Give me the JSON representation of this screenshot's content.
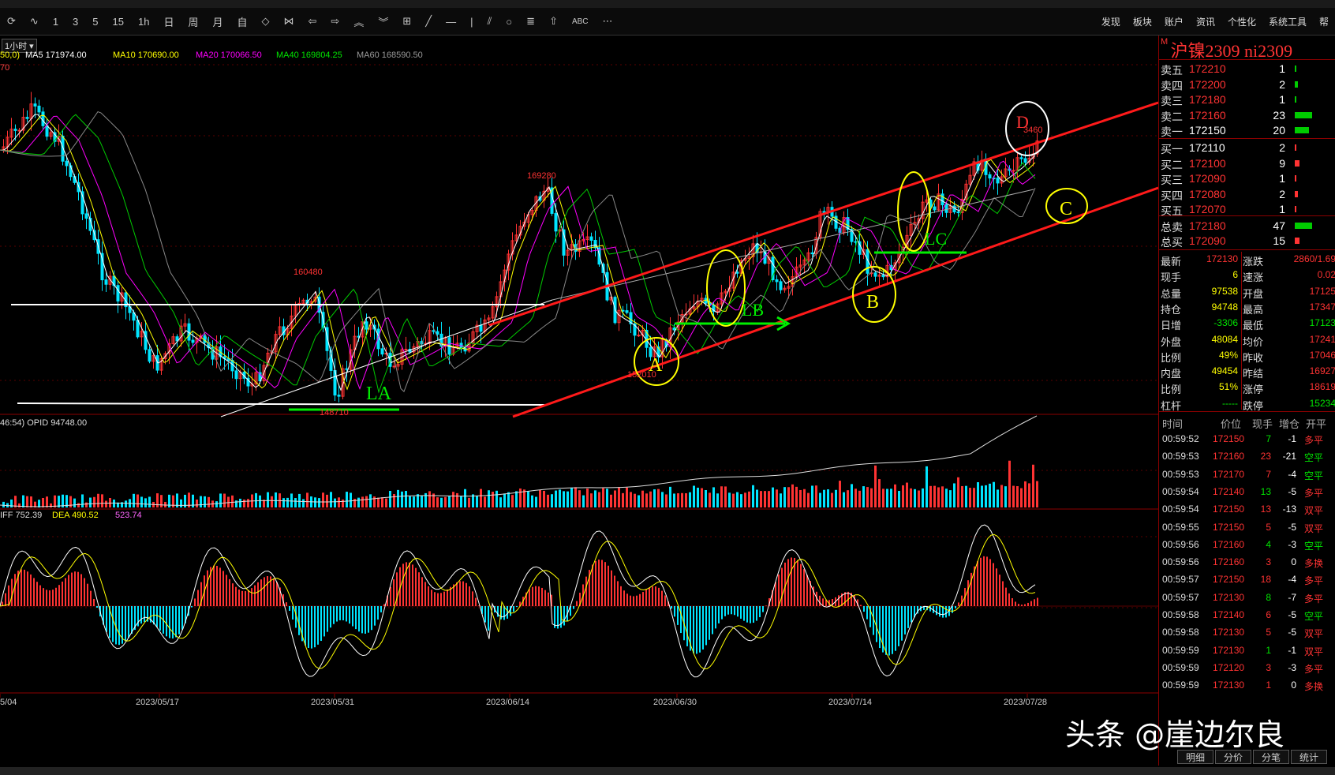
{
  "toolbar": {
    "periods": [
      "1",
      "3",
      "5",
      "15",
      "1h",
      "日",
      "周",
      "月",
      "自"
    ],
    "menu": [
      "发现",
      "板块",
      "账户",
      "资讯",
      "个性化",
      "系统工具",
      "帮"
    ]
  },
  "chart": {
    "period_select": "1小时",
    "ma_param": "50,0)",
    "ma": [
      {
        "label": "MA5 171974.00",
        "color": "#ffffff"
      },
      {
        "label": "MA10 170690.00",
        "color": "#ffff00"
      },
      {
        "label": "MA20 170066.50",
        "color": "#ff00ff"
      },
      {
        "label": "MA40 169804.25",
        "color": "#00e600"
      },
      {
        "label": "MA60 168590.50",
        "color": "#888888"
      }
    ],
    "left_edge_value": "70",
    "price_labels": {
      "p169280": "169280",
      "p160480": "160480",
      "p148710": "148710",
      "p152010": "152010",
      "p173460": "3460"
    },
    "annotations": {
      "A": "A",
      "B": "B",
      "C": "C",
      "D": "D",
      "LA": "LA",
      "LB": "LB",
      "LC": "LC"
    },
    "volume_header": "46:54)  OPID 94748.00",
    "macd_header": {
      "diff": "IFF 752.39",
      "dea": "DEA 490.52",
      "macd": "523.74"
    },
    "dates": [
      "5/04",
      "2023/05/17",
      "2023/05/31",
      "2023/06/14",
      "2023/06/30",
      "2023/07/14",
      "2023/07/28"
    ]
  },
  "panel": {
    "title": "沪镍2309  ni2309",
    "asks": [
      {
        "label": "卖五",
        "price": "172210",
        "vol": "1"
      },
      {
        "label": "卖四",
        "price": "172200",
        "vol": "2"
      },
      {
        "label": "卖三",
        "price": "172180",
        "vol": "1"
      },
      {
        "label": "卖二",
        "price": "172160",
        "vol": "23"
      },
      {
        "label": "卖一",
        "price": "172150",
        "vol": "20"
      }
    ],
    "bids": [
      {
        "label": "买一",
        "price": "172110",
        "vol": "2"
      },
      {
        "label": "买二",
        "price": "172100",
        "vol": "9"
      },
      {
        "label": "买三",
        "price": "172090",
        "vol": "1"
      },
      {
        "label": "买四",
        "price": "172080",
        "vol": "2"
      },
      {
        "label": "买五",
        "price": "172070",
        "vol": "1"
      }
    ],
    "totals": [
      {
        "label": "总卖",
        "price": "172180",
        "vol": "47"
      },
      {
        "label": "总买",
        "price": "172090",
        "vol": "15"
      }
    ],
    "stats": [
      {
        "l1": "最新",
        "v1": "172130",
        "l2": "涨跌",
        "v2": "2860/1.69"
      },
      {
        "l1": "现手",
        "v1": "6",
        "l2": "速涨",
        "v2": "0.02"
      },
      {
        "l1": "总量",
        "v1": "97538",
        "l2": "开盘",
        "v2": "17125"
      },
      {
        "l1": "持仓",
        "v1": "94748",
        "l2": "最高",
        "v2": "17347"
      },
      {
        "l1": "日增",
        "v1": "-3306",
        "l2": "最低",
        "v2": "17123"
      },
      {
        "l1": "外盘",
        "v1": "48084",
        "l2": "均价",
        "v2": "17241"
      },
      {
        "l1": "比例",
        "v1": "49%",
        "l2": "昨收",
        "v2": "17046"
      },
      {
        "l1": "内盘",
        "v1": "49454",
        "l2": "昨结",
        "v2": "16927"
      },
      {
        "l1": "比例",
        "v1": "51%",
        "l2": "涨停",
        "v2": "18619"
      },
      {
        "l1": "杠杆",
        "v1": "-----",
        "l2": "跌停",
        "v2": "15234"
      }
    ],
    "trades_header": [
      "时间",
      "价位",
      "现手",
      "增仓",
      "开平"
    ],
    "trades": [
      {
        "t": "00:59:52",
        "p": "172150",
        "v": "7",
        "d": "-1",
        "k": "多平"
      },
      {
        "t": "00:59:53",
        "p": "172160",
        "v": "23",
        "d": "-21",
        "k": "空平"
      },
      {
        "t": "00:59:53",
        "p": "172170",
        "v": "7",
        "d": "-4",
        "k": "空平"
      },
      {
        "t": "00:59:54",
        "p": "172140",
        "v": "13",
        "d": "-5",
        "k": "多平"
      },
      {
        "t": "00:59:54",
        "p": "172150",
        "v": "13",
        "d": "-13",
        "k": "双平"
      },
      {
        "t": "00:59:55",
        "p": "172150",
        "v": "5",
        "d": "-5",
        "k": "双平"
      },
      {
        "t": "00:59:56",
        "p": "172160",
        "v": "4",
        "d": "-3",
        "k": "空平"
      },
      {
        "t": "00:59:56",
        "p": "172160",
        "v": "3",
        "d": "0",
        "k": "多换"
      },
      {
        "t": "00:59:57",
        "p": "172150",
        "v": "18",
        "d": "-4",
        "k": "多平"
      },
      {
        "t": "00:59:57",
        "p": "172130",
        "v": "8",
        "d": "-7",
        "k": "多平"
      },
      {
        "t": "00:59:58",
        "p": "172140",
        "v": "6",
        "d": "-5",
        "k": "空平"
      },
      {
        "t": "00:59:58",
        "p": "172130",
        "v": "5",
        "d": "-5",
        "k": "双平"
      },
      {
        "t": "00:59:59",
        "p": "172130",
        "v": "1",
        "d": "-1",
        "k": "双平"
      },
      {
        "t": "00:59:59",
        "p": "172120",
        "v": "3",
        "d": "-3",
        "k": "多平"
      },
      {
        "t": "00:59:59",
        "p": "172130",
        "v": "1",
        "d": "0",
        "k": "多换"
      }
    ],
    "bottom_tabs": [
      "明细",
      "分价",
      "分笔",
      "统计"
    ]
  },
  "watermark": "头条 @崖边尔良"
}
